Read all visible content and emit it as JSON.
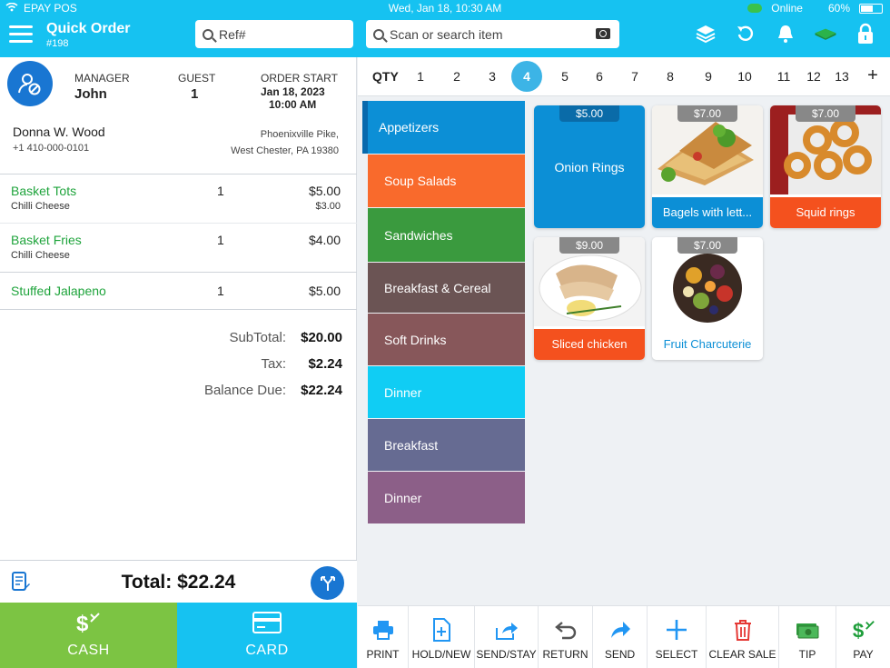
{
  "status_bar": {
    "carrier": "EPAY POS",
    "clock": "Wed, Jan 18, 10:30 AM",
    "network": "Online",
    "battery": "60%",
    "battery_level": 0.6
  },
  "header": {
    "title": "Quick Order",
    "order_number": "#198",
    "ref_placeholder": "Ref#",
    "scan_placeholder": "Scan or search item"
  },
  "order": {
    "manager_label": "MANAGER",
    "manager": "John",
    "guest_label": "GUEST",
    "guest": "1",
    "order_start_label": "ORDER START",
    "order_start_date": "Jan 18, 2023",
    "order_start_time": "10:00 AM",
    "customer_name": "Donna W. Wood",
    "customer_phone": "+1 410-000-0101",
    "address_line1": "Phoenixville Pike,",
    "address_line2": "West Chester, PA 19380"
  },
  "line_items": [
    {
      "name": "Basket Tots",
      "modifier": "Chilli Cheese",
      "qty": "1",
      "price": "$5.00",
      "modifier_price": "$3.00"
    },
    {
      "name": "Basket Fries",
      "modifier": "Chilli Cheese",
      "qty": "1",
      "price": "$4.00",
      "modifier_price": ""
    },
    {
      "name": "Stuffed Jalapeno",
      "modifier": "",
      "qty": "1",
      "price": "$5.00",
      "modifier_price": ""
    }
  ],
  "totals": {
    "subtotal_label": "SubTotal:",
    "subtotal": "$20.00",
    "tax_label": "Tax:",
    "tax": "$2.24",
    "balance_label": "Balance Due:",
    "balance": "$22.24",
    "total_text": "Total: $22.24"
  },
  "payment": {
    "cash_label": "CASH",
    "card_label": "CARD"
  },
  "qty_bar": {
    "label": "QTY",
    "numbers": [
      "1",
      "2",
      "3",
      "4",
      "5",
      "6",
      "7",
      "8",
      "9",
      "10",
      "11",
      "12",
      "13"
    ],
    "selected": "4",
    "add": "+"
  },
  "categories": [
    {
      "label": "Appetizers",
      "color": "#0c8fd6"
    },
    {
      "label": "Soup Salads",
      "color": "#f96a2c"
    },
    {
      "label": "Sandwiches",
      "color": "#3a9a3e"
    },
    {
      "label": "Breakfast & Cereal",
      "color": "#6b5454"
    },
    {
      "label": "Soft Drinks",
      "color": "#87575a"
    },
    {
      "label": "Dinner",
      "color": "#10cdf4"
    },
    {
      "label": "Breakfast",
      "color": "#666b92"
    },
    {
      "label": "Dinner",
      "color": "#8c5f88"
    }
  ],
  "items": [
    {
      "name": "Onion Rings",
      "price": "$5.00",
      "style": "plain"
    },
    {
      "name": "Bagels with lett...",
      "price": "$7.00",
      "style": "photo"
    },
    {
      "name": "Squid rings",
      "price": "$7.00",
      "style": "photo"
    },
    {
      "name": "Sliced chicken",
      "price": "$9.00",
      "style": "photo"
    },
    {
      "name": "Fruit Charcuterie",
      "price": "$7.00",
      "style": "photo-white"
    }
  ],
  "toolbar": [
    {
      "label": "PRINT",
      "icon": "printer-icon"
    },
    {
      "label": "HOLD/NEW",
      "icon": "document-plus-icon"
    },
    {
      "label": "SEND/STAY",
      "icon": "share-icon"
    },
    {
      "label": "RETURN",
      "icon": "return-icon"
    },
    {
      "label": "SEND",
      "icon": "forward-arrow-icon"
    },
    {
      "label": "SELECT",
      "icon": "plus-icon"
    },
    {
      "label": "CLEAR SALE",
      "icon": "trash-icon"
    },
    {
      "label": "TIP",
      "icon": "money-icon"
    },
    {
      "label": "PAY",
      "icon": "dollar-icon"
    }
  ],
  "colors": {
    "brand": "#16c2f1",
    "cash": "#7cc443",
    "item_green": "#1fa43c",
    "accent_blue": "#1976d2",
    "clear_red": "#e53935"
  }
}
